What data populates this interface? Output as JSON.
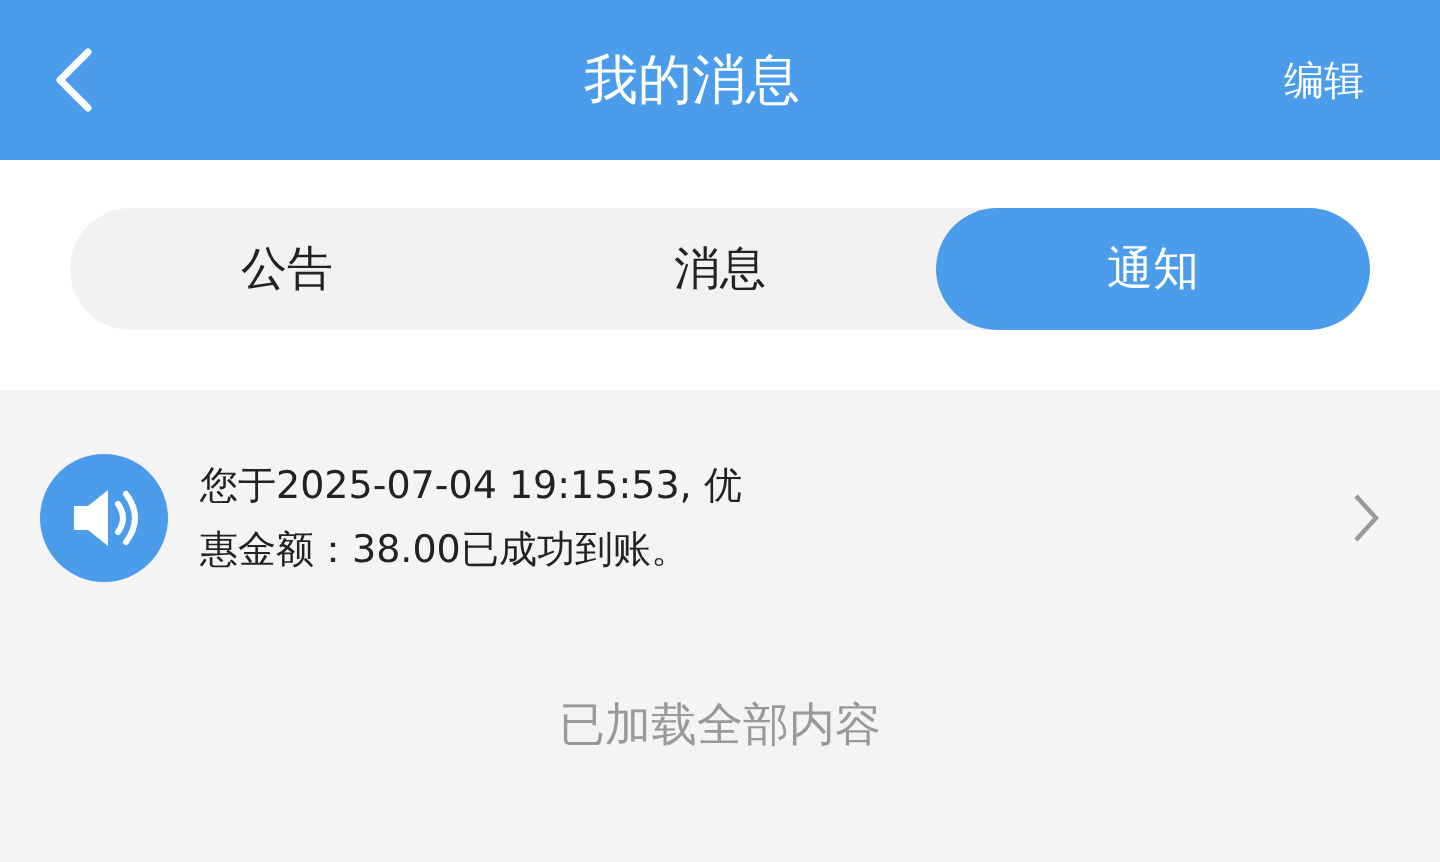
{
  "header": {
    "title": "我的消息",
    "action": "编辑"
  },
  "tabs": [
    {
      "label": "公告",
      "selected": false
    },
    {
      "label": "消息",
      "selected": false
    },
    {
      "label": "通知",
      "selected": true
    }
  ],
  "notifications": [
    {
      "text": "您于2025-07-04 19:15:53, 优惠金额：38.00已成功到账。"
    }
  ],
  "footer": "已加载全部内容"
}
